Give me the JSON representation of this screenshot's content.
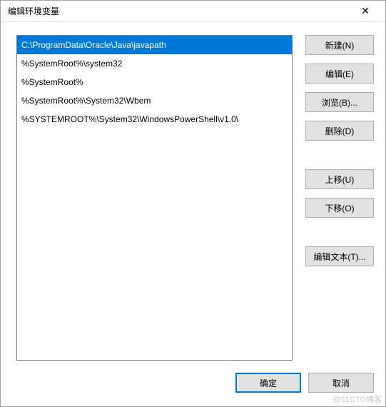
{
  "dialog": {
    "title": "编辑环境变量"
  },
  "list": {
    "items": [
      "C:\\ProgramData\\Oracle\\Java\\javapath",
      "%SystemRoot%\\system32",
      "%SystemRoot%",
      "%SystemRoot%\\System32\\Wbem",
      "%SYSTEMROOT%\\System32\\WindowsPowerShell\\v1.0\\"
    ],
    "selected_index": 0
  },
  "buttons": {
    "new": "新建(N)",
    "edit": "编辑(E)",
    "browse": "浏览(B)...",
    "delete": "删除(D)",
    "move_up": "上移(U)",
    "move_down": "下移(O)",
    "edit_text": "编辑文本(T)...",
    "ok": "确定",
    "cancel": "取消"
  },
  "watermark": "@51CTO博客"
}
